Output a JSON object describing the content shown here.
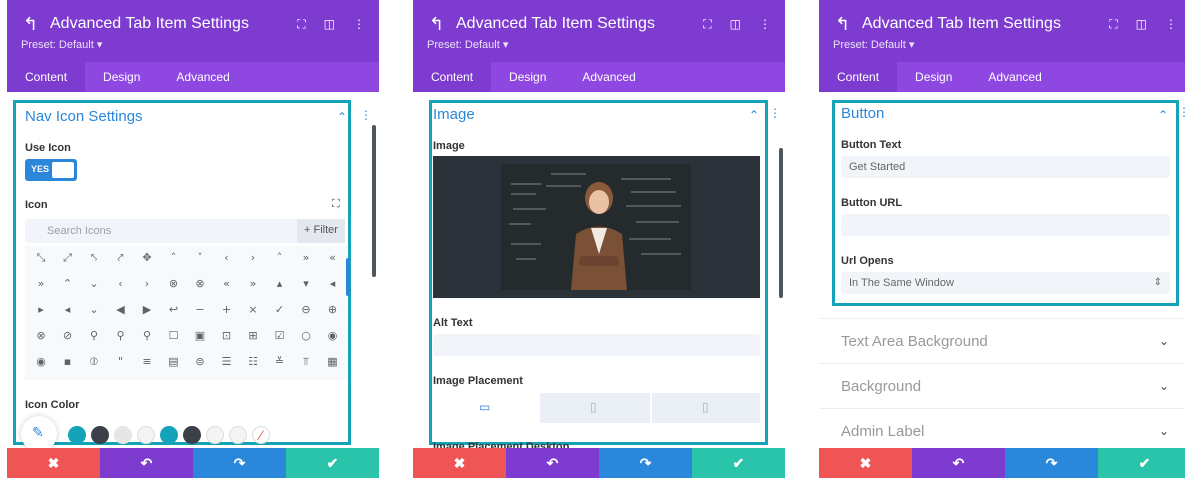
{
  "common": {
    "back_icon": "back-arrow-icon",
    "title": "Advanced Tab Item Settings",
    "preset": "Preset: Default ▾",
    "tabs": [
      "Content",
      "Design",
      "Advanced"
    ],
    "footer": {
      "discard": "✖",
      "undo": "↶",
      "redo": "↷",
      "save": "✔"
    },
    "colors": {
      "purple": "#7e3bd0",
      "blue": "#2b87da",
      "teal": "#14a3b8",
      "red": "#ef5555",
      "green": "#29c4a9"
    }
  },
  "panel1": {
    "section_title": "Nav Icon Settings",
    "use_icon_label": "Use Icon",
    "toggle_yes": "YES",
    "icon_label": "Icon",
    "search_placeholder": "Search Icons",
    "filter_label": "+ Filter",
    "icon_color_label": "Icon Color",
    "icon_rows": [
      [
        "⤡",
        "⤢",
        "⤣",
        "⤤",
        "✥",
        "˄",
        "˅",
        "‹",
        "›",
        "˄",
        "»",
        "«"
      ],
      [
        "»",
        "⌃",
        "⌄",
        "‹",
        "›",
        "⊗",
        "⊗",
        "«",
        "»",
        "▴",
        "▾",
        "◂"
      ],
      [
        "▸",
        "◂",
        "⌄",
        "◀",
        "▶",
        "↩",
        "−",
        "+",
        "×",
        "✓",
        "⊖",
        "⊕"
      ],
      [
        "⊗",
        "⊘",
        "⚲",
        "⚲",
        "⚲",
        "☐",
        "▣",
        "⊡",
        "⊞",
        "☑",
        "○",
        "◉"
      ],
      [
        "◉",
        "▪",
        "⦶",
        "\"",
        "≡",
        "▤",
        "⊜",
        "☰",
        "☷",
        "≚",
        "⫪",
        "▦"
      ]
    ]
  },
  "panel2": {
    "section_title": "Image",
    "image_label": "Image",
    "image_alt": "Teacher in front of chalkboard with formulas",
    "alt_text_label": "Alt Text",
    "alt_text_value": "",
    "image_placement_label": "Image Placement",
    "image_placement_desktop_label": "Image Placement Desktop"
  },
  "panel3": {
    "section_title": "Button",
    "button_text_label": "Button Text",
    "button_text_value": "Get Started",
    "button_url_label": "Button URL",
    "button_url_value": "",
    "url_opens_label": "Url Opens",
    "url_opens_value": "In The Same Window",
    "collapsed_sections": [
      "Text Area Background",
      "Background",
      "Admin Label"
    ]
  }
}
